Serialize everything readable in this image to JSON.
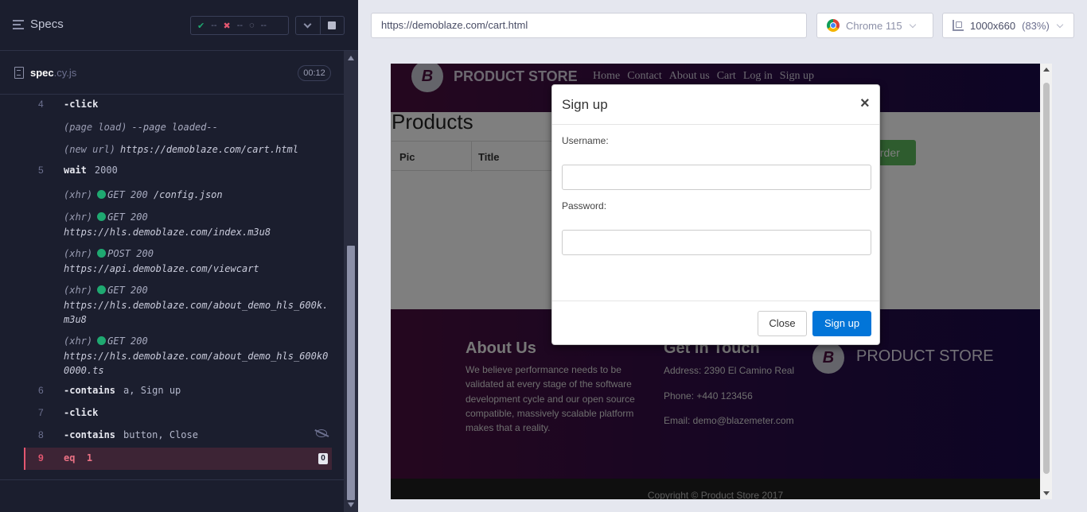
{
  "reporter": {
    "title": "Specs",
    "stats": {
      "passed": "--",
      "failed": "--",
      "pending": "--"
    },
    "spec": {
      "name": "spec",
      "ext": ".cy.js",
      "time": "00:12"
    },
    "log": [
      {
        "num": "4",
        "cmd": "-click",
        "arg": ""
      },
      {
        "tag": "(page load)",
        "text": "--page loaded--"
      },
      {
        "tag": "(new url)",
        "text": "https://demoblaze.com/cart.html"
      },
      {
        "num": "5",
        "cmd": "wait",
        "arg": "2000"
      },
      {
        "tag": "(xhr)",
        "status": "GET 200",
        "text": "/config.json"
      },
      {
        "tag": "(xhr)",
        "status": "GET 200",
        "text": "https://hls.demoblaze.com/index.m3u8"
      },
      {
        "tag": "(xhr)",
        "status": "POST 200",
        "text": "https://api.demoblaze.com/viewcart"
      },
      {
        "tag": "(xhr)",
        "status": "GET 200",
        "text": "https://hls.demoblaze.com/about_demo_hls_600k.m3u8"
      },
      {
        "tag": "(xhr)",
        "status": "GET 200",
        "text": "https://hls.demoblaze.com/about_demo_hls_600k00000.ts"
      },
      {
        "num": "6",
        "cmd": "-contains",
        "arg": "a, Sign up"
      },
      {
        "num": "7",
        "cmd": "-click",
        "arg": ""
      },
      {
        "num": "8",
        "cmd": "-contains",
        "arg": "button, Close"
      },
      {
        "num": "9",
        "cmd": "eq",
        "arg": "1",
        "badge": "0"
      }
    ]
  },
  "browser": {
    "url": "https://demoblaze.com/cart.html",
    "name": "Chrome 115",
    "viewport": "1000x660",
    "zoom": "(83%)"
  },
  "site": {
    "brand": "PRODUCT STORE",
    "logo_letter": "B",
    "nav": [
      "Home",
      "Contact",
      "About us",
      "Cart",
      "Log in",
      "Sign up"
    ],
    "heading": "Products",
    "table_headers": [
      "Pic",
      "Title"
    ],
    "place_order": "Order",
    "about_title": "About Us",
    "about_text": "We believe performance needs to be validated at every stage of the software development cycle and our open source compatible, massively scalable platform makes that a reality.",
    "touch_title": "Get in Touch",
    "address": "Address: 2390 El Camino Real",
    "phone": "Phone: +440 123456",
    "email": "Email: demo@blazemeter.com",
    "copyright": "Copyright © Product Store 2017"
  },
  "modal": {
    "title": "Sign up",
    "close_x": "×",
    "username_label": "Username:",
    "password_label": "Password:",
    "close_button": "Close",
    "signup_button": "Sign up"
  }
}
